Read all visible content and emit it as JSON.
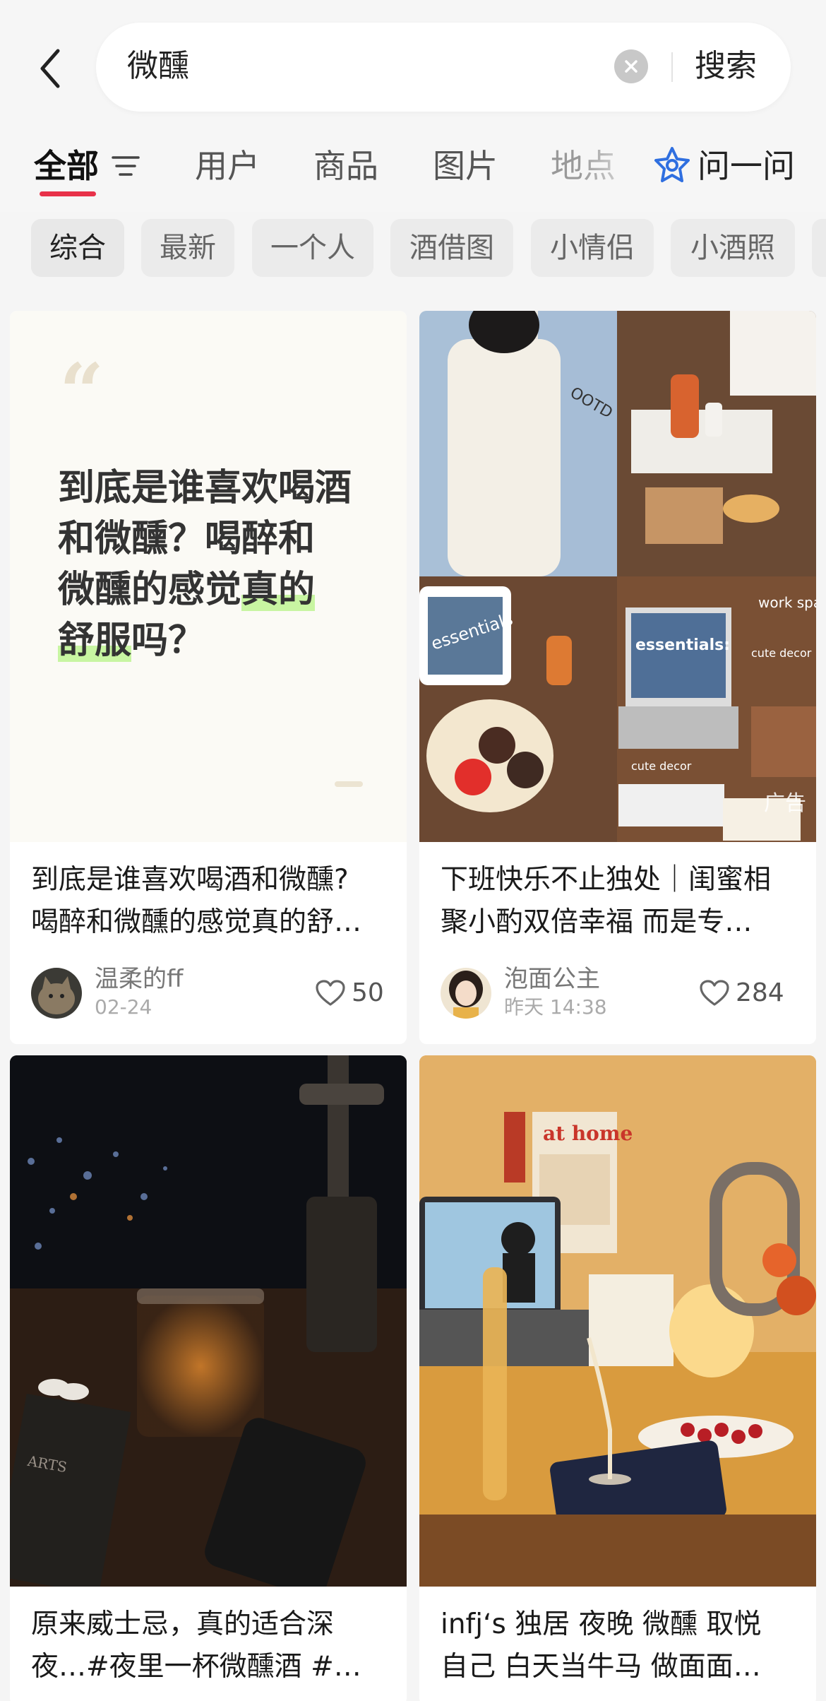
{
  "search": {
    "query": "微醺",
    "submit_label": "搜索"
  },
  "tabs": [
    {
      "label": "全部",
      "active": true
    },
    {
      "label": "用户",
      "active": false
    },
    {
      "label": "商品",
      "active": false
    },
    {
      "label": "图片",
      "active": false
    },
    {
      "label": "地点",
      "active": false
    },
    {
      "label": "问一问",
      "active": false
    }
  ],
  "chips": [
    {
      "label": "综合",
      "active": true
    },
    {
      "label": "最新",
      "active": false
    },
    {
      "label": "一个人",
      "active": false
    },
    {
      "label": "酒借图",
      "active": false
    },
    {
      "label": "小情侣",
      "active": false
    },
    {
      "label": "小酒照",
      "active": false
    }
  ],
  "cards": [
    {
      "cover_quote": {
        "lines": [
          "到底是谁喜欢喝酒",
          "和微醺？喝醉和",
          "微醺的感觉真的",
          "舒服吗？"
        ]
      },
      "title_lines": [
        "到底是谁喜欢喝酒和微醺?",
        "喝醉和微醺的感觉真的舒…"
      ],
      "author": "温柔的ff",
      "time": "02-24",
      "likes": "50"
    },
    {
      "cover_texts": [
        "OOTD",
        "essentials",
        "essentials:",
        "work space",
        "cute decor",
        "cute decor",
        "广告"
      ],
      "title_lines": [
        "下班快乐不止独处｜闺蜜相",
        "聚小酌双倍幸福 而是专…"
      ],
      "author": "泡面公主",
      "time": "昨天 14:38",
      "likes": "284"
    },
    {
      "cover_texts": [
        "ARTS"
      ],
      "title_lines": [
        "原来威士忌，真的适合深",
        "夜…#夜里一杯微醺酒 #…"
      ]
    },
    {
      "cover_texts": [
        "at home"
      ],
      "title_lines": [
        "infj‘s 独居 夜晚 微醺 取悦",
        "自己 白天当牛马 做面面…"
      ]
    }
  ],
  "colors": {
    "accent": "#e8324a",
    "highlight": "#c8f5a2",
    "ask_icon": "#2f6fe0"
  }
}
